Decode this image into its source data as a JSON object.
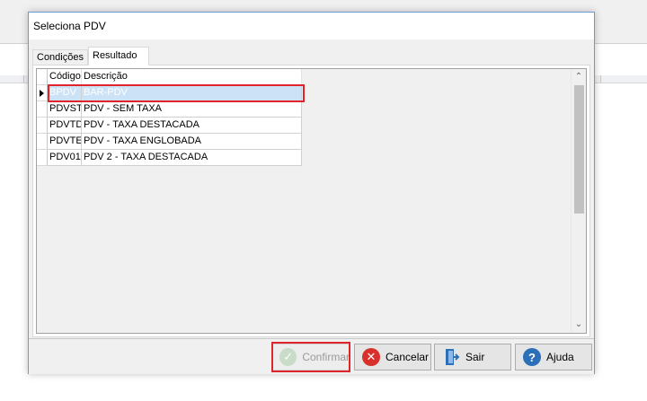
{
  "dialog": {
    "title": "Seleciona PDV"
  },
  "tabs": [
    {
      "label": "Condições",
      "active": false
    },
    {
      "label": "Resultado",
      "active": true
    }
  ],
  "grid": {
    "columns": [
      "Código",
      "Descrição"
    ],
    "rows": [
      {
        "code": "BPDV",
        "desc": "BAR-PDV",
        "selected": true
      },
      {
        "code": "PDVST",
        "desc": "PDV - SEM TAXA"
      },
      {
        "code": "PDVTD",
        "desc": "PDV - TAXA DESTACADA"
      },
      {
        "code": "PDVTE",
        "desc": "PDV - TAXA ENGLOBADA"
      },
      {
        "code": "PDV01",
        "desc": "PDV 2 - TAXA DESTACADA"
      }
    ]
  },
  "buttons": {
    "confirm": "Confirmar",
    "cancel": "Cancelar",
    "exit": "Sair",
    "help": "Ajuda"
  },
  "icons": {
    "check": "check-icon",
    "cancel": "cancel-x-icon",
    "exit": "exit-door-icon",
    "help": "help-question-icon"
  },
  "colors": {
    "selection": "#cce2f7",
    "highlight": "#e0242b",
    "cancel_icon": "#d9302c",
    "help_icon": "#2a6fb8"
  }
}
